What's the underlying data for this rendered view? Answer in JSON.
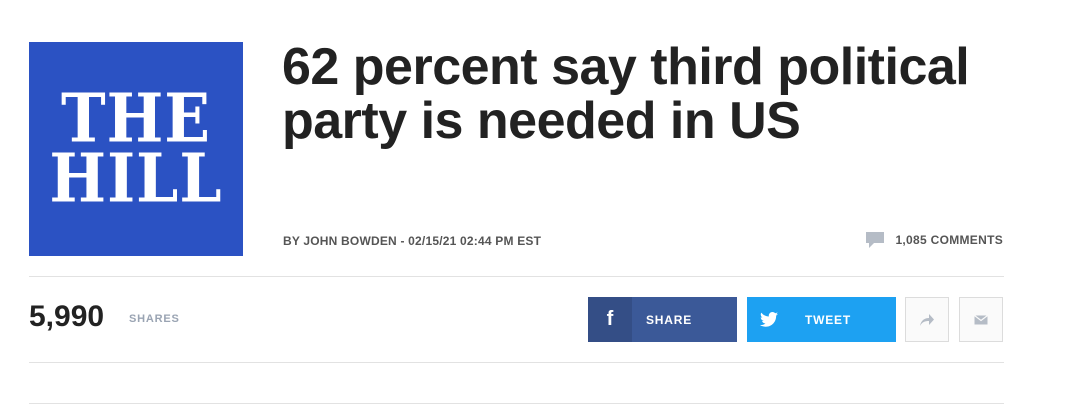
{
  "logo": {
    "line1": "THE",
    "line2": "HILL",
    "color": "#2b52c3"
  },
  "article": {
    "headline": "62 percent say third political party is needed in US",
    "byline": "BY JOHN BOWDEN - 02/15/21 02:44 PM EST",
    "comments_label": "1,085 COMMENTS"
  },
  "shares": {
    "count": "5,990",
    "label": "SHARES"
  },
  "buttons": {
    "facebook": {
      "label": "SHARE",
      "icon": "f",
      "color": "#3b5998",
      "icon_bg": "#344e86"
    },
    "twitter": {
      "label": "TWEET",
      "icon": "twitter-bird-icon",
      "color": "#1da1f2"
    },
    "forward_icon": "share-arrow-icon",
    "email_icon": "envelope-icon"
  },
  "colors": {
    "headline": "#222222",
    "meta": "#555555",
    "shares_label": "#9aa4b3",
    "divider": "#e2e2e2"
  }
}
